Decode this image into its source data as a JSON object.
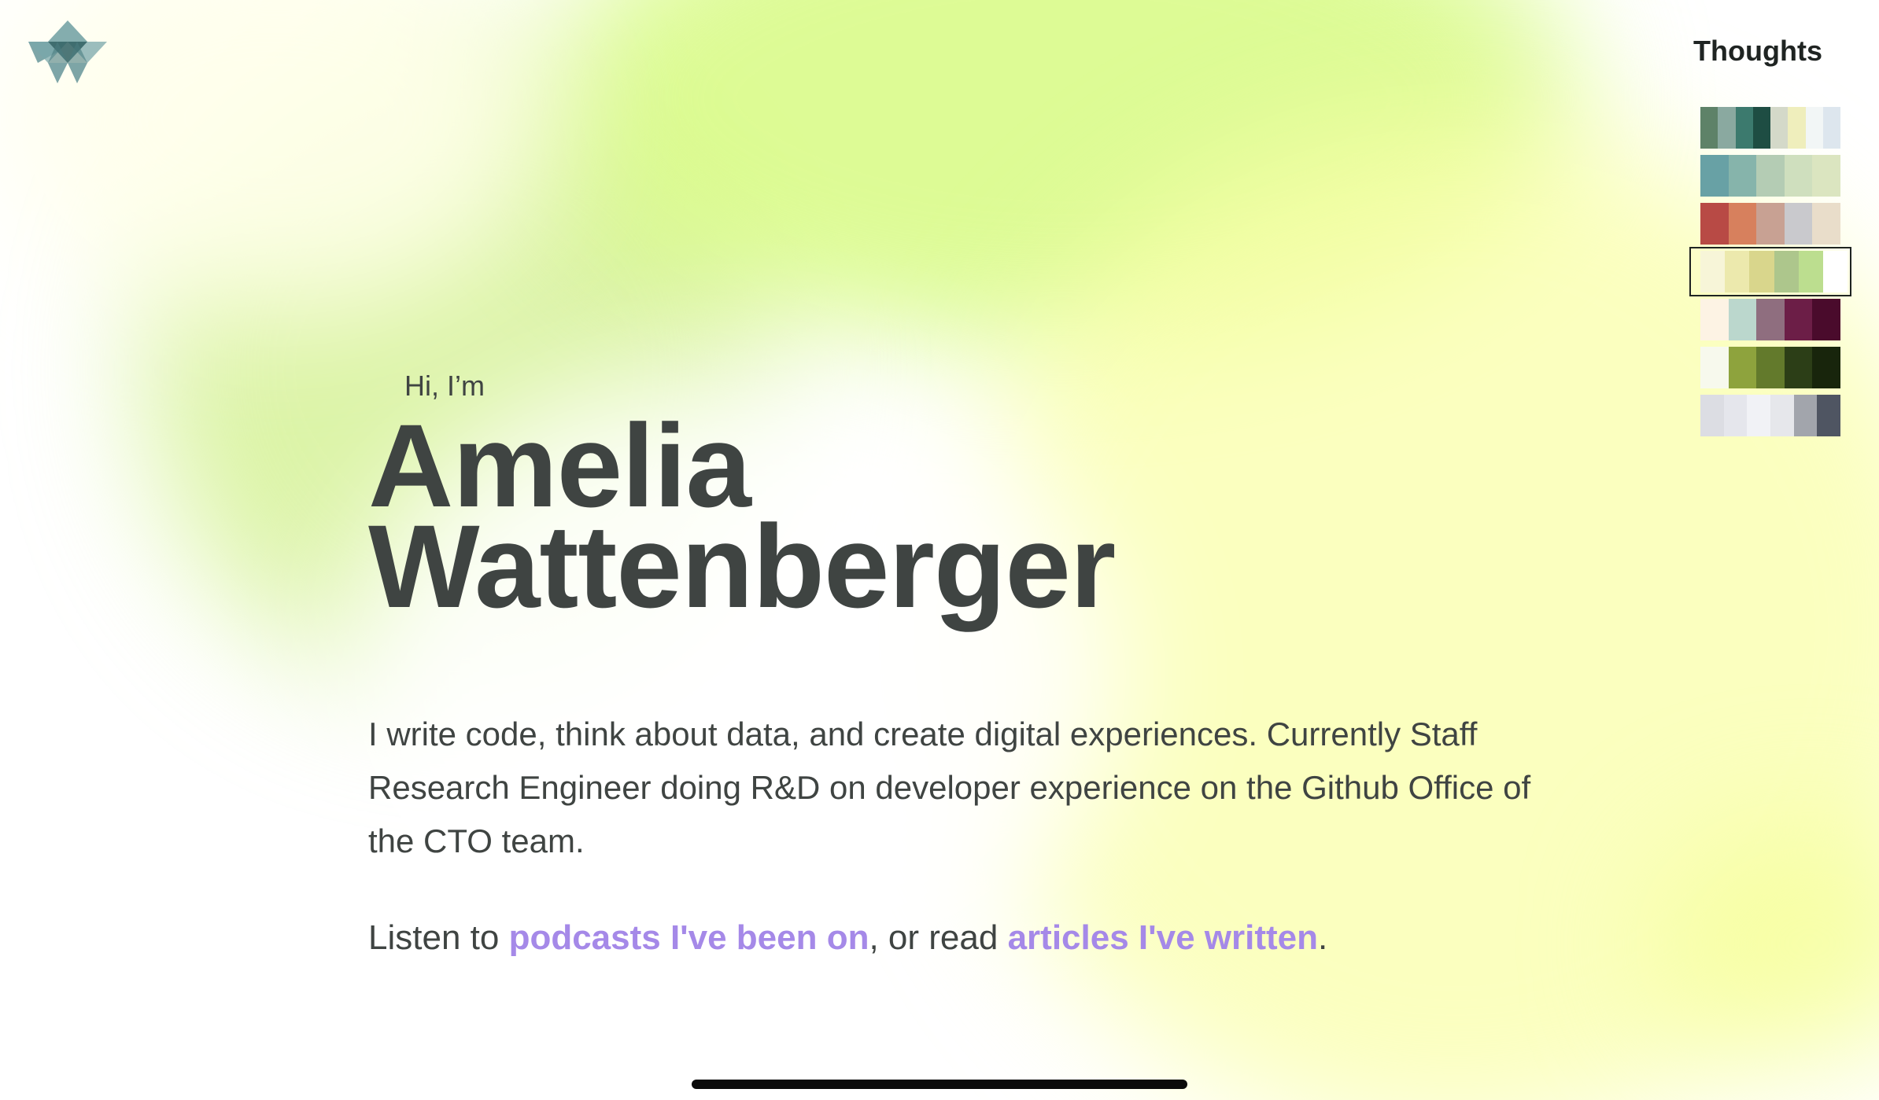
{
  "header": {
    "logo_icon": "triangle-logo-icon",
    "nav_link": "Thoughts"
  },
  "palettes": [
    {
      "colors": [
        "#5e8268",
        "#8aa9a0",
        "#3c7a6e",
        "#1e4d43",
        "#d4d9c9",
        "#efeebc",
        "#f2f6f6",
        "#dde6ee"
      ]
    },
    {
      "colors": [
        "#68a1a5",
        "#86b4ab",
        "#b4ccb4",
        "#cfdfbe",
        "#dbe5c0"
      ]
    },
    {
      "colors": [
        "#b84a45",
        "#d7805d",
        "#c8a193",
        "#c9c9cd",
        "#e9ddca"
      ]
    },
    {
      "colors": [
        "#f7f5d8",
        "#ece9ad",
        "#d9d68c",
        "#adc68c",
        "#bcde8f",
        "#ffffff"
      ],
      "selected": true
    },
    {
      "colors": [
        "#fdf3e4",
        "#bbd7cd",
        "#8f6e7f",
        "#6c1e47",
        "#4a0b2c"
      ]
    },
    {
      "colors": [
        "#f7f9ed",
        "#8ea33d",
        "#637a2c",
        "#2c3e17",
        "#18250c"
      ]
    },
    {
      "colors": [
        "#dcdde3",
        "#e5e6ec",
        "#f1f2f6",
        "#e6e7eb",
        "#a2a5ac",
        "#4f5562"
      ]
    }
  ],
  "hero": {
    "greeting": "Hi, I’m",
    "first_name": "Amelia",
    "last_name": "Wattenberger",
    "bio": "I write code, think about data, and create digital experiences. Currently Staff Research Engineer doing R&D on developer experience on the Github Office of the CTO team.",
    "links_prefix": "Listen to ",
    "podcasts_link": "podcasts I've been on",
    "links_middle": ", or read ",
    "articles_link": "articles I've written",
    "links_suffix": "."
  },
  "colors": {
    "text": "#3f4442",
    "link": "#a589e8",
    "accent_green": "#d7fa82"
  }
}
